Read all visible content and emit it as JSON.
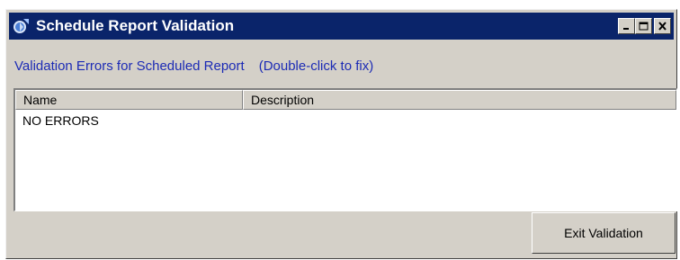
{
  "window": {
    "title": "Schedule Report Validation",
    "icon": "app-icon",
    "title_bar_color": "#0a246a"
  },
  "heading": {
    "main": "Validation Errors for Scheduled Report",
    "hint": "(Double-click to fix)",
    "color": "#1c2bb5"
  },
  "list": {
    "columns": [
      "Name",
      "Description"
    ],
    "rows": [
      {
        "name": "NO ERRORS",
        "description": ""
      }
    ]
  },
  "footer": {
    "exit_label": "Exit Validation"
  }
}
